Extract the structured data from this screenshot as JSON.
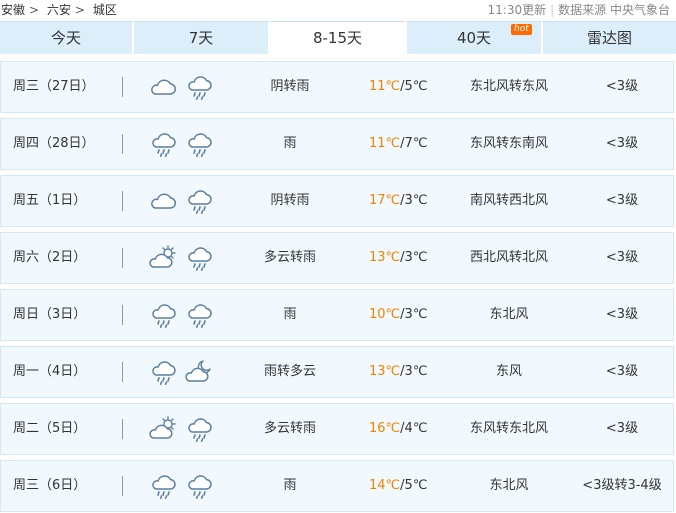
{
  "breadcrumb": [
    "安徽",
    "六安",
    "城区"
  ],
  "breadcrumb_sep": ">",
  "meta": {
    "updated": "11:30更新",
    "source_label": "数据来源",
    "source": "中央气象台"
  },
  "tabs": [
    {
      "label": "今天"
    },
    {
      "label": "7天"
    },
    {
      "label": "8-15天"
    },
    {
      "label": "40天",
      "badge": "hot"
    },
    {
      "label": "雷达图"
    }
  ],
  "active_tab": "8-15天",
  "colors": {
    "tab_bg": "#dbeefa",
    "row_bg": "#f2f9fe",
    "row_border": "#d5e8f5",
    "high_temp": "#f08300",
    "hot_badge": "#ff6a00"
  },
  "days": [
    {
      "date": "周三（27日）",
      "icon_day": "cloudy-icon",
      "icon_night": "rain-icon",
      "desc": "阴转雨",
      "high": "11℃",
      "sep": "/",
      "low": "5℃",
      "wind": "东北风转东风",
      "level": "<3级"
    },
    {
      "date": "周四（28日）",
      "icon_day": "rain-icon",
      "icon_night": "rain-icon",
      "desc": "雨",
      "high": "11℃",
      "sep": "/",
      "low": "7℃",
      "wind": "东风转东南风",
      "level": "<3级"
    },
    {
      "date": "周五（1日）",
      "icon_day": "cloudy-icon",
      "icon_night": "rain-icon",
      "desc": "阴转雨",
      "high": "17℃",
      "sep": "/",
      "low": "3℃",
      "wind": "南风转西北风",
      "level": "<3级"
    },
    {
      "date": "周六（2日）",
      "icon_day": "partly-cloudy-icon",
      "icon_night": "rain-icon",
      "desc": "多云转雨",
      "high": "13℃",
      "sep": "/",
      "low": "3℃",
      "wind": "西北风转北风",
      "level": "<3级"
    },
    {
      "date": "周日（3日）",
      "icon_day": "rain-icon",
      "icon_night": "rain-icon",
      "desc": "雨",
      "high": "10℃",
      "sep": "/",
      "low": "3℃",
      "wind": "东北风",
      "level": "<3级"
    },
    {
      "date": "周一（4日）",
      "icon_day": "rain-icon",
      "icon_night": "cloudy-night-icon",
      "desc": "雨转多云",
      "high": "13℃",
      "sep": "/",
      "low": "3℃",
      "wind": "东风",
      "level": "<3级"
    },
    {
      "date": "周二（5日）",
      "icon_day": "partly-cloudy-icon",
      "icon_night": "rain-icon",
      "desc": "多云转雨",
      "high": "16℃",
      "sep": "/",
      "low": "4℃",
      "wind": "东风转东北风",
      "level": "<3级"
    },
    {
      "date": "周三（6日）",
      "icon_day": "rain-icon",
      "icon_night": "rain-icon",
      "desc": "雨",
      "high": "14℃",
      "sep": "/",
      "low": "5℃",
      "wind": "东北风",
      "level": "<3级转3-4级"
    }
  ]
}
